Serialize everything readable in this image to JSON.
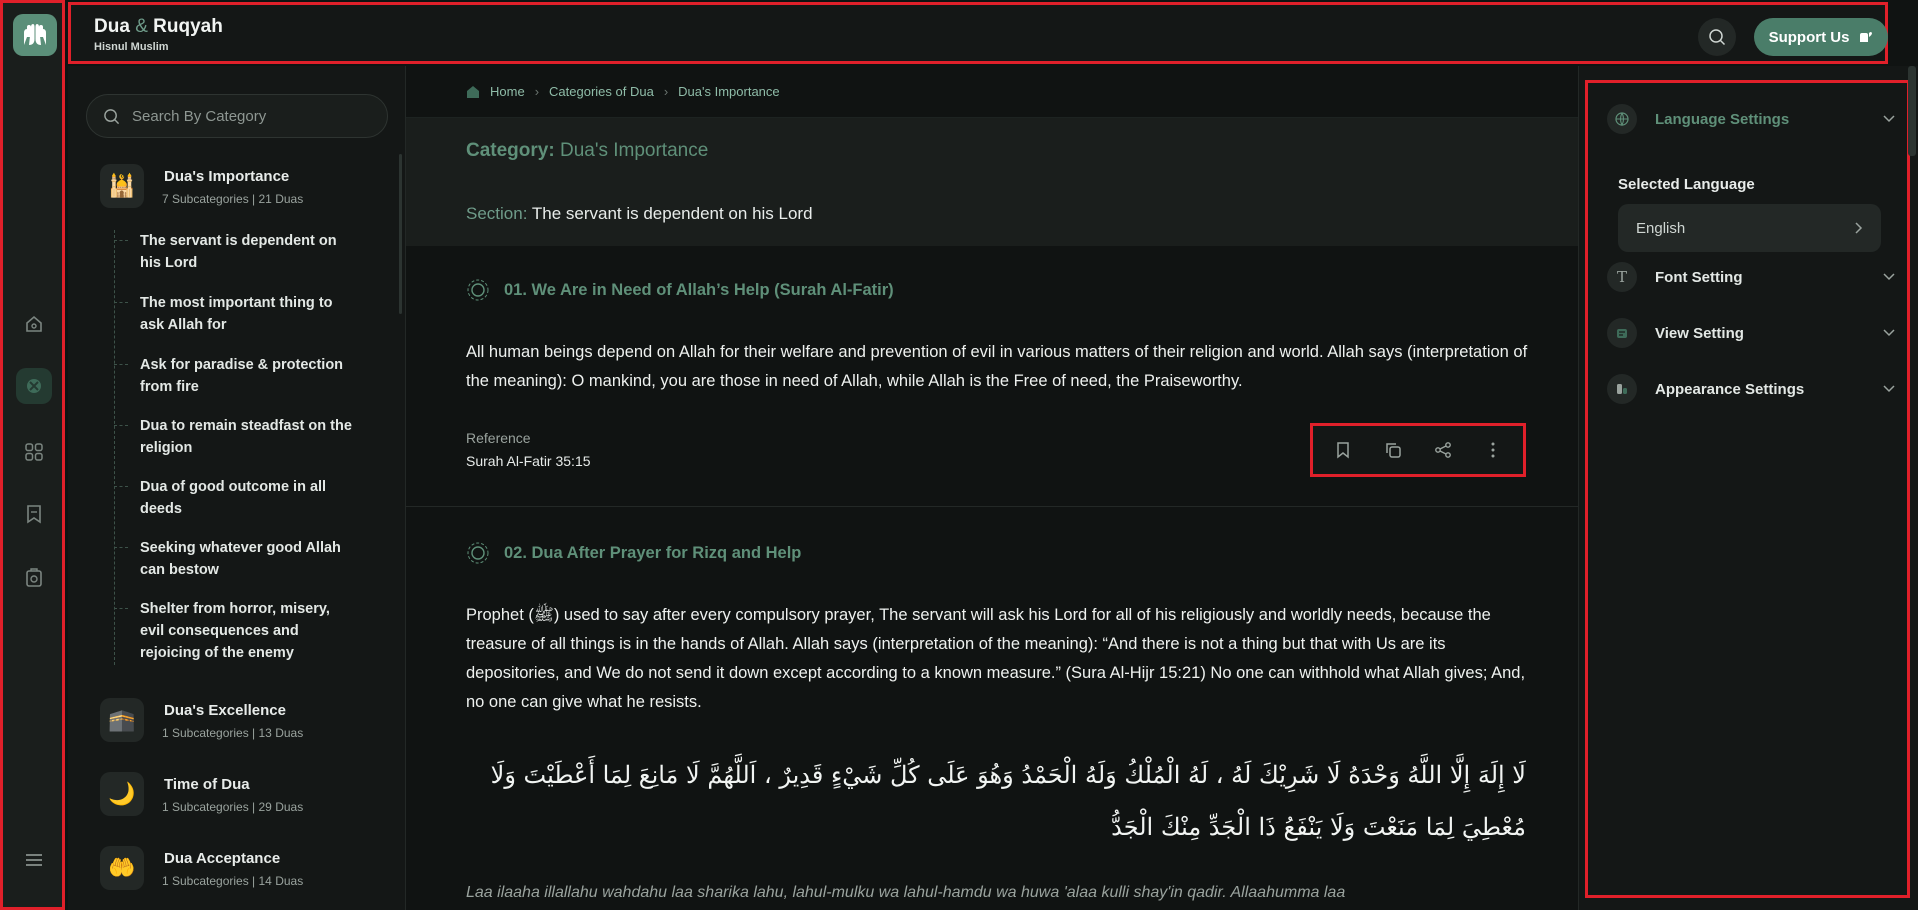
{
  "header": {
    "brand_main": "Dua",
    "brand_amp": "&",
    "brand_second": "Ruqyah",
    "brand_sub": "Hisnul Muslim",
    "support_label": "Support Us"
  },
  "rail": {
    "items": [
      "home-icon",
      "categories-icon",
      "grid-icon",
      "bookmark-icon",
      "ruqyah-icon"
    ],
    "menu_icon": "menu-icon"
  },
  "categories": {
    "search_placeholder": "Search By Category",
    "items": [
      {
        "name": "Dua's Importance",
        "meta": "7 Subcategories | 21 Duas",
        "icon": "🕌"
      },
      {
        "name": "Dua's Excellence",
        "meta": "1 Subcategories | 13 Duas",
        "icon": "🕋"
      },
      {
        "name": "Time of Dua",
        "meta": "1 Subcategories | 29 Duas",
        "icon": "🌙"
      },
      {
        "name": "Dua Acceptance",
        "meta": "1 Subcategories | 14 Duas",
        "icon": "🤲"
      }
    ],
    "subcategories": [
      "The servant is dependent on his Lord",
      "The most important thing to ask Allah for",
      "Ask for paradise & protection from fire",
      "Dua to remain steadfast on the religion",
      "Dua of good outcome in all deeds",
      "Seeking whatever good Allah can bestow",
      "Shelter from horror, misery, evil consequences and rejoicing of the enemy"
    ]
  },
  "breadcrumb": {
    "home": "Home",
    "categories": "Categories of Dua",
    "current": "Dua's Importance"
  },
  "category_bar": {
    "category_key": "Category:",
    "category_value": "Dua's Importance",
    "section_key": "Section:",
    "section_value": "The servant is dependent on his Lord"
  },
  "duas": [
    {
      "title": "01. We Are in Need of Allah’s Help (Surah Al-Fatir)",
      "body": "All human beings depend on Allah for their welfare and prevention of evil in various matters of their religion and world. Allah says (interpretation of the meaning): O mankind, you are those in need of Allah, while Allah is the Free of need, the Praiseworthy.",
      "reference_label": "Reference",
      "reference_value": "Surah Al-Fatir 35:15"
    },
    {
      "title": "02. Dua After Prayer for Rizq and Help",
      "body": "Prophet (ﷺ) used to say after every compulsory prayer, The servant will ask his Lord for all of his religiously and worldly needs, because the treasure of all things is in the hands of Allah. Allah says (interpretation of the meaning): “And there is not a thing but that with Us are its depositories, and We do not send it down except according to a known measure.” (Sura Al-Hijr 15:21) No one can withhold what Allah gives; And, no one can give what he resists.",
      "arabic": "لَا إِلَهَ إِلَّا اللَّهُ وَحْدَهُ لَا شَرِيْكَ لَهُ ، لَهُ الْمُلْكُ وَلَهُ الْحَمْدُ وَهُوَ عَلَى كُلِّ شَيْءٍ قَدِيرٌ ، اَللَّهُمَّ لَا مَانِعَ لِمَا أَعْطَيْتَ وَلَا مُعْطِيَ لِمَا مَنَعْتَ وَلَا يَنْفَعُ ذَا الْجَدِّ مِنْكَ الْجَدُّ",
      "transliteration": "Laa ilaaha illallahu wahdahu laa sharika lahu, lahul-mulku wa lahul-hamdu wa huwa 'alaa kulli shay'in qadir. Allaahumma laa"
    }
  ],
  "actions": [
    "bookmark-icon",
    "copy-icon",
    "share-icon",
    "more-icon"
  ],
  "settings": {
    "language": "Language Settings",
    "selected_language_label": "Selected Language",
    "selected_language": "English",
    "font": "Font Setting",
    "view": "View Setting",
    "appearance": "Appearance Settings"
  },
  "colors": {
    "accent": "#5f9079",
    "highlight_box": "#e0202a",
    "background": "#101312"
  }
}
